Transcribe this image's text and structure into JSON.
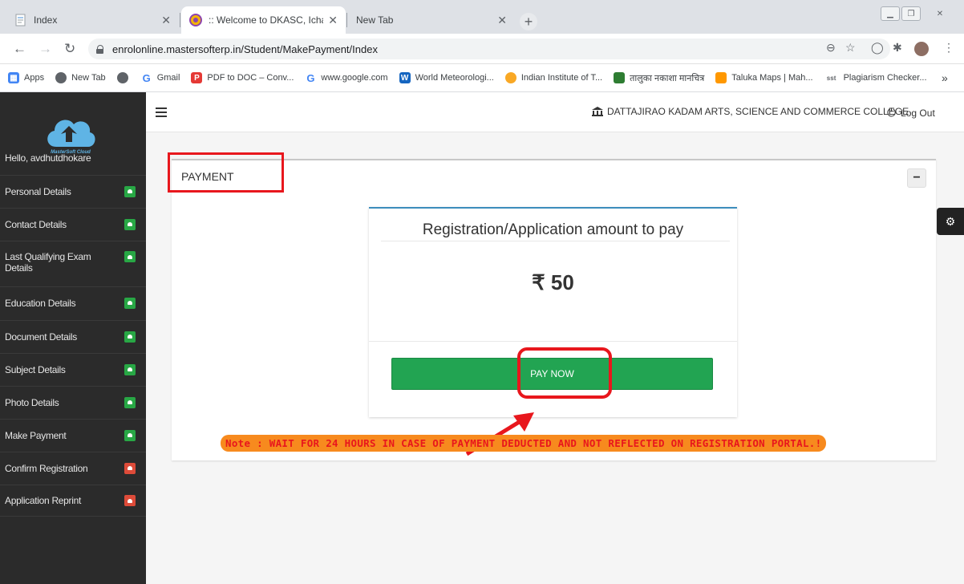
{
  "browser": {
    "tabs": [
      {
        "title": "Index"
      },
      {
        "title": ":: Welcome to DKASC, Ichalkaranji"
      },
      {
        "title": "New Tab"
      }
    ],
    "url": "enrolonline.mastersofterp.in/Student/MakePayment/Index",
    "bookmarks": [
      {
        "label": "Apps"
      },
      {
        "label": "New Tab"
      },
      {
        "label": ""
      },
      {
        "label": "Gmail"
      },
      {
        "label": "PDF to DOC – Conv..."
      },
      {
        "label": "www.google.com"
      },
      {
        "label": "World Meteorologi..."
      },
      {
        "label": "Indian Institute of T..."
      },
      {
        "label": "तालुका नकाशा मानचित्र"
      },
      {
        "label": "Taluka Maps | Mah..."
      },
      {
        "label": "Plagiarism Checker..."
      }
    ],
    "more_label": "»"
  },
  "sidebar": {
    "logo_text": "MasterSoft Cloud",
    "greeting": "Hello, avdhutdhokare",
    "items": [
      {
        "label": "Personal Details",
        "status": "complete"
      },
      {
        "label": "Contact Details",
        "status": "complete"
      },
      {
        "label": "Last Qualifying Exam Details",
        "status": "complete"
      },
      {
        "label": "Education Details",
        "status": "complete"
      },
      {
        "label": "Document Details",
        "status": "complete"
      },
      {
        "label": "Subject Details",
        "status": "complete"
      },
      {
        "label": "Photo Details",
        "status": "complete"
      },
      {
        "label": "Make Payment",
        "status": "complete"
      },
      {
        "label": "Confirm Registration",
        "status": "pending"
      },
      {
        "label": "Application Reprint",
        "status": "pending"
      }
    ],
    "colors": {
      "complete": "#28a745",
      "pending": "#dd4b39"
    }
  },
  "header": {
    "college": "DATTAJIRAO KADAM ARTS, SCIENCE AND COMMERCE COLLEGE",
    "logout": "Log Out"
  },
  "panel": {
    "title": "PAYMENT",
    "collapse_label": "−",
    "card": {
      "title": "Registration/Application amount to pay",
      "amount": "₹ 50",
      "pay_button": "PAY NOW"
    },
    "note": "Note : WAIT FOR 24 HOURS IN CASE OF PAYMENT DEDUCTED AND NOT REFLECTED ON REGISTRATION PORTAL.!"
  },
  "annotation_color": "#e8171d"
}
